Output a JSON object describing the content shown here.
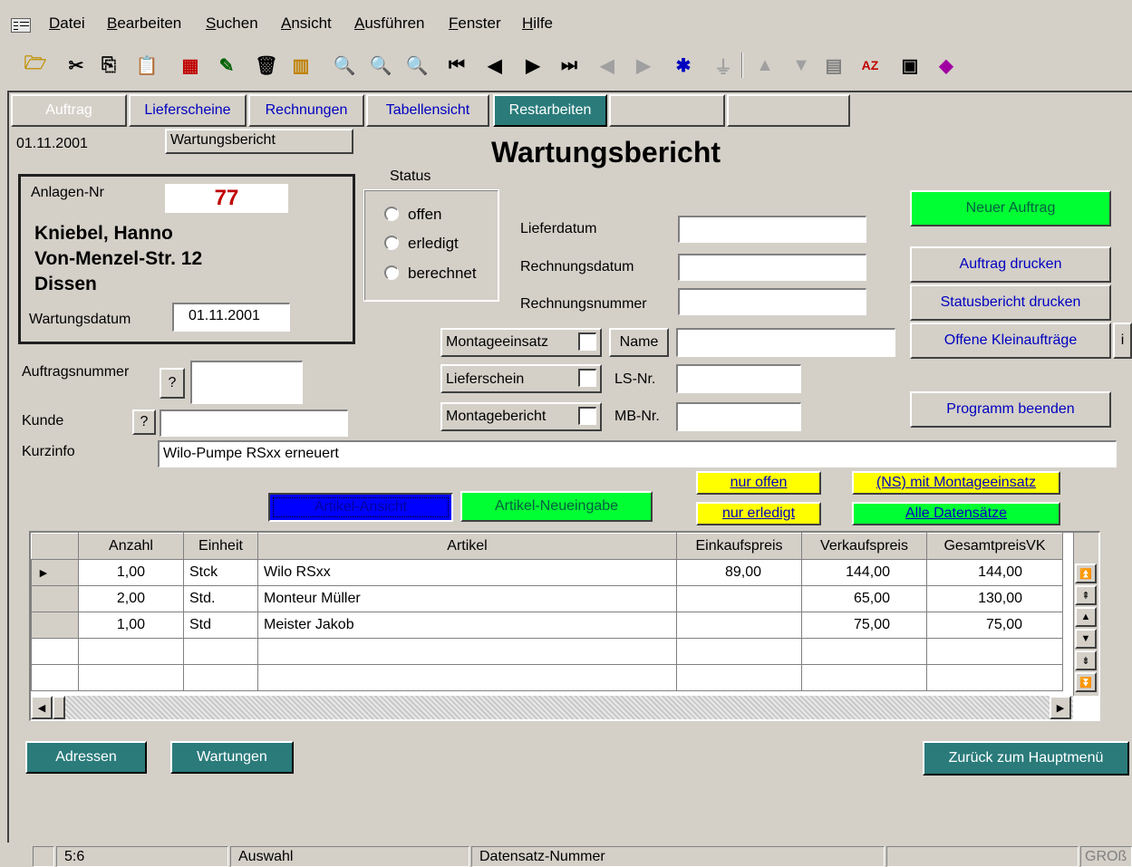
{
  "menu": [
    "Datei",
    "Bearbeiten",
    "Suchen",
    "Ansicht",
    "Ausführen",
    "Fenster",
    "Hilfe"
  ],
  "toolbar_icons": [
    "open-folder-icon",
    "cut-icon",
    "copy-icon",
    "paste-icon",
    "form-icon",
    "edit-form-icon",
    "delete-icon",
    "chart-icon",
    "find-icon",
    "find-replace-icon",
    "find-next-icon",
    "first-record-icon",
    "prev-record-icon",
    "next-record-icon",
    "last-record-icon",
    "prev-new-icon",
    "next-new-icon",
    "new-record-icon",
    "filter-icon",
    "sort-up-icon",
    "sort-down-icon",
    "table-icon",
    "sort-az-icon",
    "window-icon",
    "book-icon"
  ],
  "tabs": [
    "Auftrag",
    "Lieferscheine",
    "Rechnungen",
    "Tabellensicht",
    "Restarbeiten"
  ],
  "header": {
    "date": "01.11.2001",
    "report_field": "Wartungsbericht",
    "title": "Wartungsbericht"
  },
  "anlage": {
    "label": "Anlagen-Nr",
    "number": "77",
    "name": "Kniebel, Hanno",
    "street": "Von-Menzel-Str. 12",
    "city": "Dissen",
    "wartung_label": "Wartungsdatum",
    "wartung_date": "01.11.2001"
  },
  "status": {
    "label": "Status",
    "options": [
      "offen",
      "erledigt",
      "berechnet"
    ]
  },
  "dates": {
    "lieferdatum": "Lieferdatum",
    "rechnungsdatum": "Rechnungsdatum",
    "rechnungsnummer": "Rechnungsnummer"
  },
  "checks": {
    "montageeinsatz": "Montageeinsatz",
    "name": "Name",
    "lieferschein": "Lieferschein",
    "ls_nr": "LS-Nr.",
    "montagebericht": "Montagebericht",
    "mb_nr": "MB-Nr."
  },
  "buttons": {
    "neuer_auftrag": "Neuer Auftrag",
    "auftrag_drucken": "Auftrag drucken",
    "statusbericht_drucken": "Statusbericht drucken",
    "offene_kleinauftraege": "Offene Kleinaufträge",
    "info": "i",
    "programm_beenden": "Programm beenden",
    "nur_offen": "nur offen",
    "nur_erledigt": "nur erledigt",
    "ns_montage": "(NS) mit Montageeinsatz",
    "alle": "Alle Datensätze",
    "artikel_ansicht": "Artikel-Ansicht",
    "artikel_neu": "Artikel-Neueingabe",
    "adressen": "Adressen",
    "wartungen": "Wartungen",
    "zurueck": "Zurück zum Hauptmenü",
    "help": "?"
  },
  "form": {
    "auftragsnummer": "Auftragsnummer",
    "kunde": "Kunde",
    "kurzinfo": "Kurzinfo",
    "kurzinfo_value": "Wilo-Pumpe RSxx erneuert"
  },
  "grid": {
    "columns": [
      "Anzahl",
      "Einheit",
      "Artikel",
      "Einkaufspreis",
      "Verkaufspreis",
      "GesamtpreisVK"
    ],
    "rows": [
      [
        "1,00",
        "Stck",
        "Wilo RSxx",
        "89,00",
        "144,00",
        "144,00"
      ],
      [
        "2,00",
        "Std.",
        "Monteur Müller",
        "",
        "65,00",
        "130,00"
      ],
      [
        "1,00",
        "Std",
        "Meister Jakob",
        "",
        "75,00",
        "75,00"
      ]
    ]
  },
  "statusbar": [
    "5:6",
    "Auswahl",
    "Datensatz-Nummer",
    "GROß"
  ],
  "colors": {
    "green": "#00ff33",
    "yellow": "#ffff00",
    "blue": "#0000ff",
    "teal": "#2b7b7b",
    "link_blue": "#0000c0",
    "red": "#c00000"
  }
}
